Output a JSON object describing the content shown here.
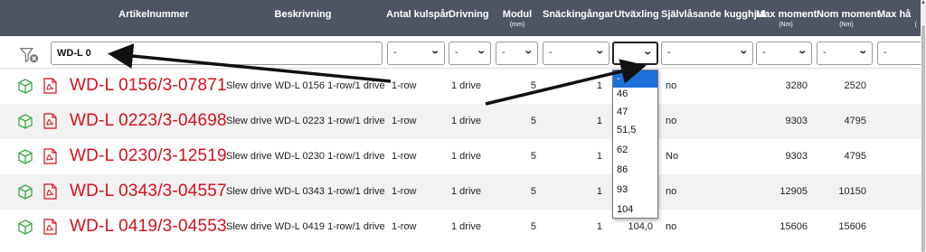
{
  "header": {
    "columns": [
      {
        "label": "Artikelnummer",
        "unit": ""
      },
      {
        "label": "Beskrivning",
        "unit": ""
      },
      {
        "label": "Antal kulspår",
        "unit": ""
      },
      {
        "label": "Drivning",
        "unit": ""
      },
      {
        "label": "Modul",
        "unit": "(mm)"
      },
      {
        "label": "Snäckingångar",
        "unit": ""
      },
      {
        "label": "Utväxling",
        "unit": ""
      },
      {
        "label": "Självlåsande kugghjul",
        "unit": ""
      },
      {
        "label": "Max moment",
        "unit": "(Nm)"
      },
      {
        "label": "Nom moment",
        "unit": "(Nm)"
      },
      {
        "label": "Max hå",
        "unit": "("
      }
    ]
  },
  "filters": {
    "text_value": "WD-L 0",
    "selects": [
      "-",
      "-",
      "-",
      "-",
      "",
      "-",
      "-",
      "-",
      "-"
    ]
  },
  "dropdown": {
    "options": [
      "-",
      "46",
      "47",
      "51,5",
      "62",
      "86",
      "93",
      "104"
    ],
    "selected": "-"
  },
  "rows": [
    {
      "artnr": "WD-L 0156/3-07871",
      "desc": "Slew drive WD-L 0156 1-row/1 drive",
      "rows": "1-row",
      "drive": "1 drive",
      "module": "5",
      "starts": "1",
      "ratio": "",
      "selflock": "no",
      "max_moment": "3280",
      "nom_moment": "2520"
    },
    {
      "artnr": "WD-L 0223/3-04698",
      "desc": "Slew drive WD-L 0223 1-row/1 drive",
      "rows": "1-row",
      "drive": "1 drive",
      "module": "5",
      "starts": "1",
      "ratio": "",
      "selflock": "no",
      "max_moment": "9303",
      "nom_moment": "4795"
    },
    {
      "artnr": "WD-L 0230/3-12519",
      "desc": "Slew drive WD-L 0230 1-row/1 drive",
      "rows": "1-row",
      "drive": "1 drive",
      "module": "5",
      "starts": "1",
      "ratio": "",
      "selflock": "No",
      "max_moment": "9303",
      "nom_moment": "4795"
    },
    {
      "artnr": "WD-L 0343/3-04557",
      "desc": "Slew drive WD-L 0343 1-row/1 drive",
      "rows": "1-row",
      "drive": "1 drive",
      "module": "5",
      "starts": "1",
      "ratio": "",
      "selflock": "no",
      "max_moment": "12905",
      "nom_moment": "10150"
    },
    {
      "artnr": "WD-L 0419/3-04553",
      "desc": "Slew drive WD-L 0419 1-row/1 drive",
      "rows": "1-row",
      "drive": "1 drive",
      "module": "5",
      "starts": "1",
      "ratio": "104,0",
      "selflock": "no",
      "max_moment": "15606",
      "nom_moment": "15606"
    }
  ],
  "icons": {
    "model": "cube-icon",
    "datasheet": "pdf-icon",
    "clear_filter": "filter-clear-icon"
  },
  "colors": {
    "header_bg": "#4d5562",
    "artnr": "#d4111c",
    "model_icon": "#3aa845",
    "pdf_icon": "#d4111c",
    "highlight": "#1e6fd8"
  }
}
